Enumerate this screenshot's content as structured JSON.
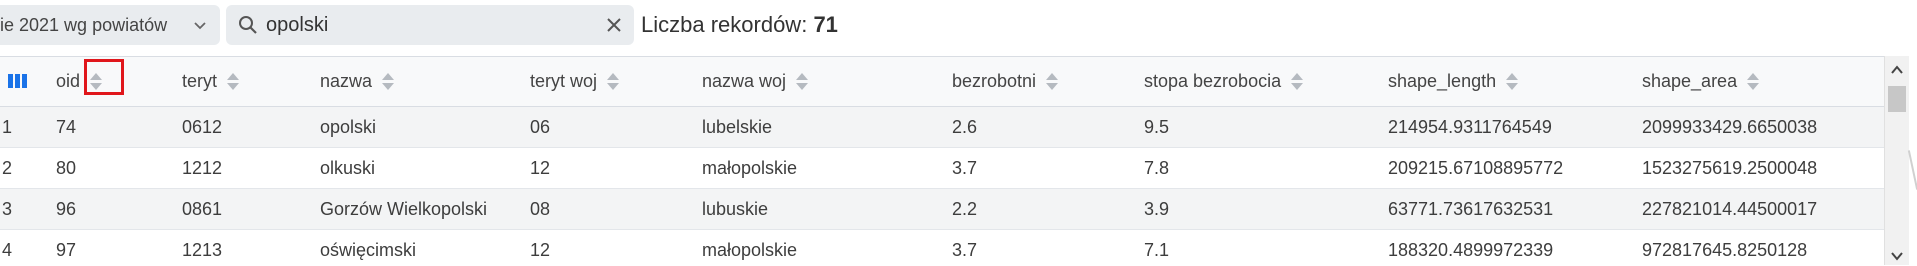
{
  "toolbar": {
    "layer_select_value": "ie 2021 wg powiatów",
    "search_value": "opolski",
    "record_count_label": "Liczba rekordów:",
    "record_count_value": "71"
  },
  "table": {
    "columns": [
      "oid",
      "teryt",
      "nazwa",
      "teryt woj",
      "nazwa woj",
      "bezrobotni",
      "stopa bezrobocia",
      "shape_length",
      "shape_area"
    ],
    "rows": [
      {
        "n": "1",
        "cells": [
          "74",
          "0612",
          "opolski",
          "06",
          "lubelskie",
          "2.6",
          "9.5",
          "214954.9311764549",
          "2099933429.6650038"
        ]
      },
      {
        "n": "2",
        "cells": [
          "80",
          "1212",
          "olkuski",
          "12",
          "małopolskie",
          "3.7",
          "7.8",
          "209215.67108895772",
          "1523275619.2500048"
        ]
      },
      {
        "n": "3",
        "cells": [
          "96",
          "0861",
          "Gorzów Wielkopolski",
          "08",
          "lubuskie",
          "2.2",
          "3.9",
          "63771.73617632531",
          "227821014.44500017"
        ]
      },
      {
        "n": "4",
        "cells": [
          "97",
          "1213",
          "oświęcimski",
          "12",
          "małopolskie",
          "3.7",
          "7.1",
          "188320.4899972339",
          "972817645.8250128"
        ]
      }
    ]
  },
  "icons": {
    "columns_icon": "columns-icon",
    "search_icon": "search-icon",
    "clear_icon": "close-icon",
    "dropdown_icon": "chevron-down-icon",
    "sort_icon": "sort-icon"
  },
  "colors": {
    "accent": "#1a73e8",
    "highlight": "#e0161b",
    "header_bg": "#f8f9fa",
    "row_odd_bg": "#f3f4f5",
    "control_bg": "#e9ecef"
  }
}
